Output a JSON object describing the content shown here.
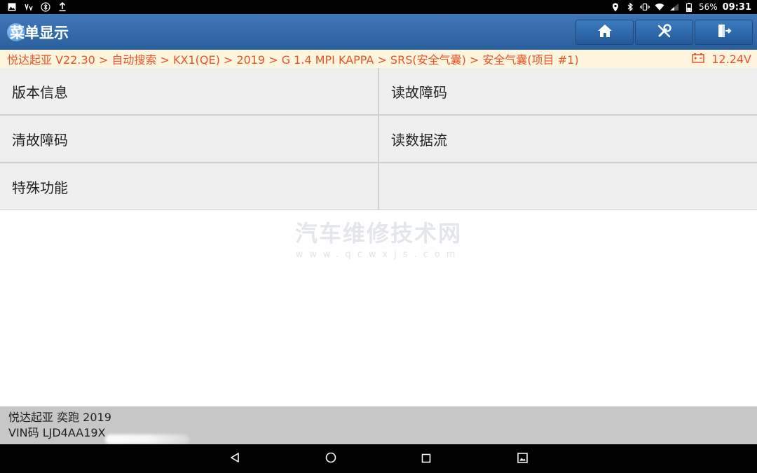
{
  "statusbar": {
    "battery": "56%",
    "time": "09:31"
  },
  "header": {
    "title": "菜单显示",
    "buttons": [
      {
        "icon": "home-icon"
      },
      {
        "icon": "tools-icon"
      },
      {
        "icon": "exit-icon"
      }
    ]
  },
  "breadcrumb": {
    "path": "悦达起亚 V22.30 > 自动搜索 > KX1(QE) > 2019 > G 1.4 MPI KAPPA > SRS(安全气囊) > 安全气囊(项目 #1)",
    "voltage": "12.24V",
    "color": "#e8532c"
  },
  "menu": {
    "items": [
      {
        "label": "版本信息"
      },
      {
        "label": "读故障码"
      },
      {
        "label": "清故障码"
      },
      {
        "label": "读数据流"
      },
      {
        "label": "特殊功能"
      },
      {
        "label": ""
      }
    ]
  },
  "watermark": {
    "title": "汽车维修技术网",
    "url": "www.qcwxjs.com"
  },
  "vehicle": {
    "model": "悦达起亚 奕跑 2019",
    "vin": "VIN码 LJD4AA19X"
  },
  "colors": {
    "titlebar": "#2f68a8",
    "breadcrumb_bg": "#fdf5dd",
    "cell_bg": "#efefef"
  }
}
